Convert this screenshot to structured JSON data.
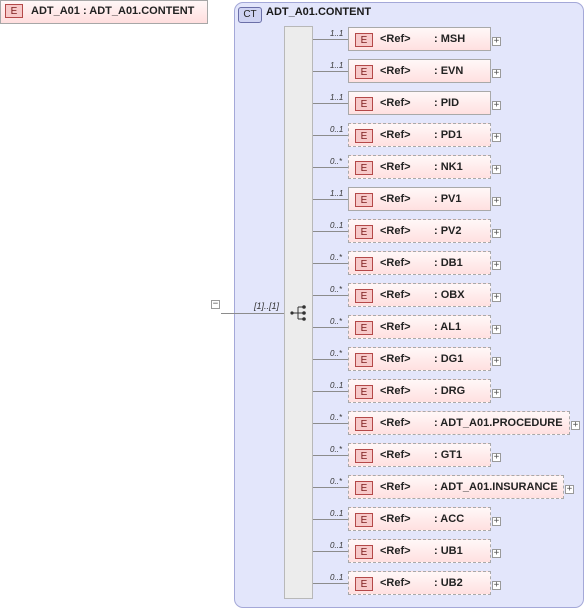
{
  "complex_type": {
    "badge": "CT",
    "name": "ADT_A01.CONTENT"
  },
  "root_element": {
    "badge": "E",
    "label": "ADT_A01 : ADT_A01.CONTENT",
    "multiplicity": "[1]..[1]",
    "expander": "−"
  },
  "sequence_icon": "sequence-compositor-icon",
  "children": [
    {
      "badge": "E",
      "ref": "<Ref>",
      "name": ": MSH",
      "multiplicity": "1..1",
      "optional": false
    },
    {
      "badge": "E",
      "ref": "<Ref>",
      "name": ": EVN",
      "multiplicity": "1..1",
      "optional": false
    },
    {
      "badge": "E",
      "ref": "<Ref>",
      "name": ": PID",
      "multiplicity": "1..1",
      "optional": false
    },
    {
      "badge": "E",
      "ref": "<Ref>",
      "name": ": PD1",
      "multiplicity": "0..1",
      "optional": true
    },
    {
      "badge": "E",
      "ref": "<Ref>",
      "name": ": NK1",
      "multiplicity": "0..*",
      "optional": true
    },
    {
      "badge": "E",
      "ref": "<Ref>",
      "name": ": PV1",
      "multiplicity": "1..1",
      "optional": false
    },
    {
      "badge": "E",
      "ref": "<Ref>",
      "name": ": PV2",
      "multiplicity": "0..1",
      "optional": true
    },
    {
      "badge": "E",
      "ref": "<Ref>",
      "name": ": DB1",
      "multiplicity": "0..*",
      "optional": true
    },
    {
      "badge": "E",
      "ref": "<Ref>",
      "name": ": OBX",
      "multiplicity": "0..*",
      "optional": true
    },
    {
      "badge": "E",
      "ref": "<Ref>",
      "name": ": AL1",
      "multiplicity": "0..*",
      "optional": true
    },
    {
      "badge": "E",
      "ref": "<Ref>",
      "name": ": DG1",
      "multiplicity": "0..*",
      "optional": true
    },
    {
      "badge": "E",
      "ref": "<Ref>",
      "name": ": DRG",
      "multiplicity": "0..1",
      "optional": true
    },
    {
      "badge": "E",
      "ref": "<Ref>",
      "name": ": ADT_A01.PROCEDURE",
      "multiplicity": "0..*",
      "optional": true
    },
    {
      "badge": "E",
      "ref": "<Ref>",
      "name": ": GT1",
      "multiplicity": "0..*",
      "optional": true
    },
    {
      "badge": "E",
      "ref": "<Ref>",
      "name": ": ADT_A01.INSURANCE",
      "multiplicity": "0..*",
      "optional": true
    },
    {
      "badge": "E",
      "ref": "<Ref>",
      "name": ": ACC",
      "multiplicity": "0..1",
      "optional": true
    },
    {
      "badge": "E",
      "ref": "<Ref>",
      "name": ": UB1",
      "multiplicity": "0..1",
      "optional": true
    },
    {
      "badge": "E",
      "ref": "<Ref>",
      "name": ": UB2",
      "multiplicity": "0..1",
      "optional": true
    }
  ],
  "child_expander": "+"
}
